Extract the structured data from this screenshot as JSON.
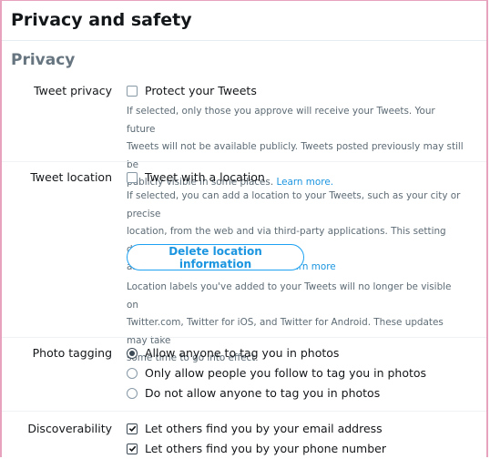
{
  "header": {
    "title": "Privacy and safety"
  },
  "section": {
    "title": "Privacy"
  },
  "tweet_privacy": {
    "label": "Tweet privacy",
    "option": "Protect your Tweets",
    "checked": false,
    "help_lines": [
      "If selected, only those you approve will receive your Tweets. Your future",
      "Tweets will not be available publicly. Tweets posted previously may still be"
    ],
    "help_last": "publicly visible in some places. ",
    "learn_more": "Learn more."
  },
  "tweet_location": {
    "label": "Tweet location",
    "option": "Tweet with a location",
    "checked": false,
    "help_lines": [
      "If selected, you can add a location to your Tweets, such as your city or precise",
      "location, from the web and via third-party applications. This setting does not"
    ],
    "help_last": "affect Twitter for iOS or Android. ",
    "learn_more": "Learn more",
    "delete_button": "Delete location information",
    "note_lines": [
      "Location labels you've added to your Tweets will no longer be visible on",
      "Twitter.com, Twitter for iOS, and Twitter for Android. These updates may take",
      "some time to go into effect."
    ]
  },
  "photo_tagging": {
    "label": "Photo tagging",
    "options": [
      {
        "label": "Allow anyone to tag you in photos",
        "selected": true
      },
      {
        "label": "Only allow people you follow to tag you in photos",
        "selected": false
      },
      {
        "label": "Do not allow anyone to tag you in photos",
        "selected": false
      }
    ]
  },
  "discoverability": {
    "label": "Discoverability",
    "options": [
      {
        "label": "Let others find you by your email address",
        "checked": true
      },
      {
        "label": "Let others find you by your phone number",
        "checked": true
      }
    ]
  }
}
